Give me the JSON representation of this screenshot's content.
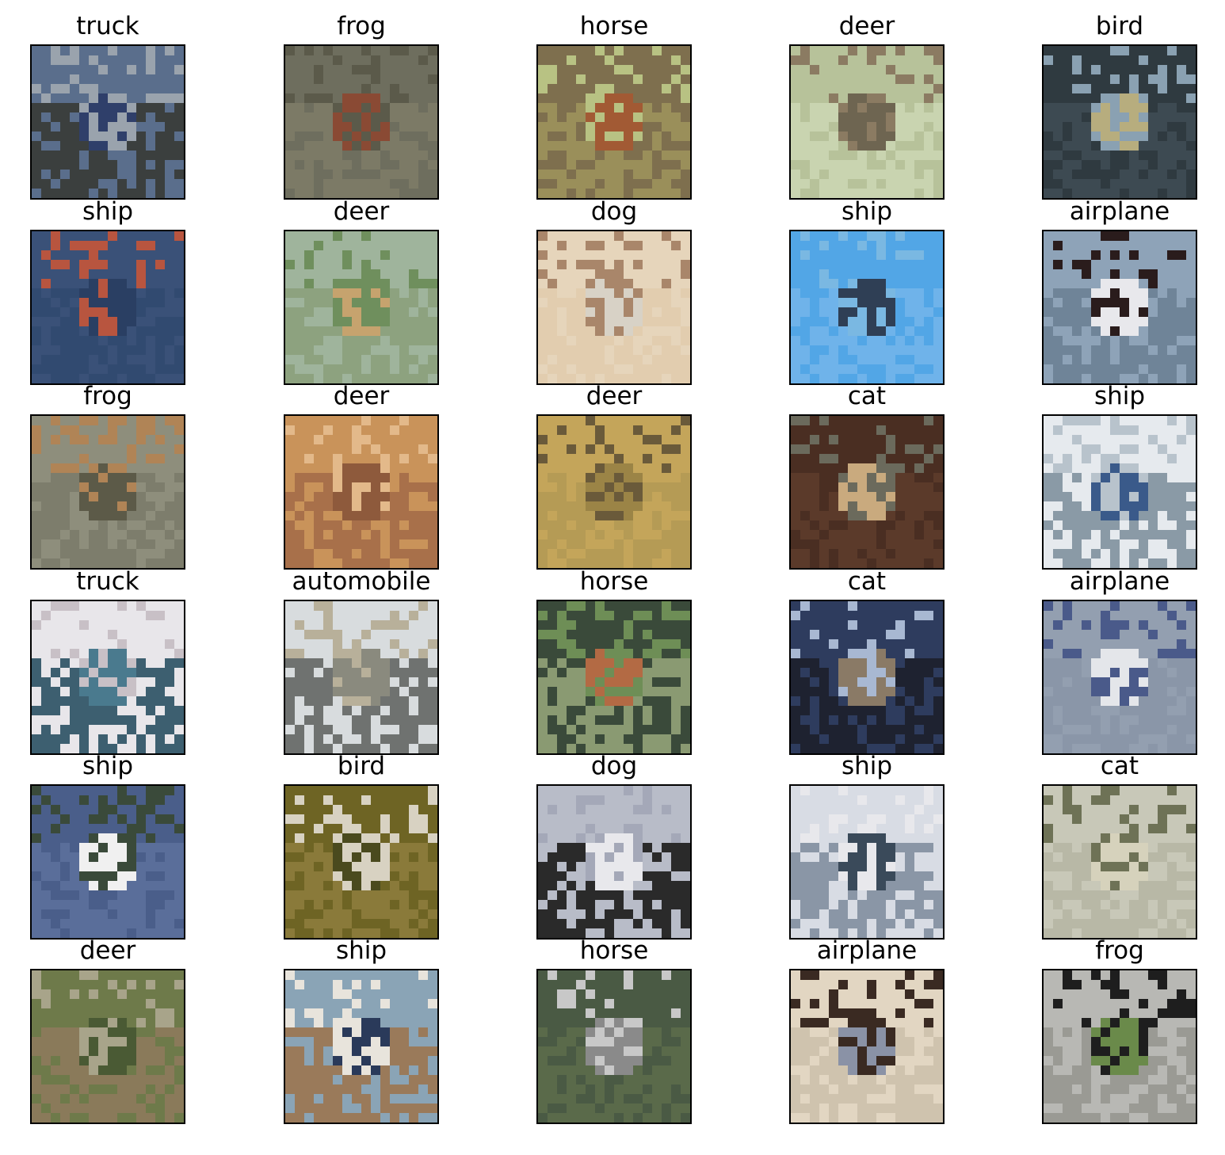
{
  "grid": {
    "rows": 6,
    "cols": 5,
    "cells": [
      {
        "label": "truck",
        "palette": [
          "#5a6e8c",
          "#2f3f6a",
          "#9aa3ad",
          "#3b3f3e"
        ]
      },
      {
        "label": "frog",
        "palette": [
          "#6e6e5e",
          "#8a4a34",
          "#5b5a4a",
          "#7c7a66"
        ]
      },
      {
        "label": "horse",
        "palette": [
          "#7e6f4e",
          "#a25a34",
          "#b8c283",
          "#9a8f5a"
        ]
      },
      {
        "label": "deer",
        "palette": [
          "#b7c29a",
          "#6e6551",
          "#8b7b62",
          "#c9d4b0"
        ]
      },
      {
        "label": "bird",
        "palette": [
          "#2f3a40",
          "#b7ad7e",
          "#8aa1b2",
          "#3d4a52"
        ]
      },
      {
        "label": "ship",
        "palette": [
          "#3a5178",
          "#2a3f63",
          "#b8553f",
          "#314a70"
        ]
      },
      {
        "label": "deer",
        "palette": [
          "#9fb49c",
          "#c6a36e",
          "#6f8f5d",
          "#8da27f"
        ]
      },
      {
        "label": "dog",
        "palette": [
          "#e6d5bb",
          "#d8d2c6",
          "#a9866a",
          "#e2cdaf"
        ]
      },
      {
        "label": "ship",
        "palette": [
          "#52a6e6",
          "#2f3f55",
          "#7ab8e2",
          "#6fb3ea"
        ]
      },
      {
        "label": "airplane",
        "palette": [
          "#8ea3b8",
          "#e8e8ec",
          "#2a1c1c",
          "#6f8498"
        ]
      },
      {
        "label": "frog",
        "palette": [
          "#8e8e7c",
          "#5c5a48",
          "#b08456",
          "#7d7d6c"
        ]
      },
      {
        "label": "deer",
        "palette": [
          "#c9935a",
          "#8e5a3c",
          "#e3b98a",
          "#a8704a"
        ]
      },
      {
        "label": "deer",
        "palette": [
          "#c4a55a",
          "#9b8446",
          "#6a5a3a",
          "#b59b55"
        ]
      },
      {
        "label": "cat",
        "palette": [
          "#4a2e22",
          "#c9aa7e",
          "#6b6a5c",
          "#5b3a2a"
        ]
      },
      {
        "label": "ship",
        "palette": [
          "#e6eaee",
          "#3a5a8a",
          "#b8c3cc",
          "#8a9aa6"
        ]
      },
      {
        "label": "truck",
        "palette": [
          "#e8e6ea",
          "#4a7a8e",
          "#c8c0c6",
          "#3d5f70"
        ]
      },
      {
        "label": "automobile",
        "palette": [
          "#d8dcde",
          "#8a8a7e",
          "#b8b09a",
          "#6f7270"
        ]
      },
      {
        "label": "horse",
        "palette": [
          "#3a4a3a",
          "#b36a44",
          "#6e8e56",
          "#8a9a72"
        ]
      },
      {
        "label": "cat",
        "palette": [
          "#2e3c5e",
          "#8a7a66",
          "#a8b8d2",
          "#1e2230"
        ]
      },
      {
        "label": "airplane",
        "palette": [
          "#939fb0",
          "#e4e6ea",
          "#4a5a8a",
          "#8a96a8"
        ]
      },
      {
        "label": "ship",
        "palette": [
          "#4a5e8a",
          "#f0f0f0",
          "#3a4a3a",
          "#5a6e9a"
        ]
      },
      {
        "label": "bird",
        "palette": [
          "#6e6424",
          "#4a4a1e",
          "#d8d2c2",
          "#8a7a3a"
        ]
      },
      {
        "label": "dog",
        "palette": [
          "#b8bcc8",
          "#e8e8ec",
          "#a4a8b8",
          "#2a2a2a"
        ]
      },
      {
        "label": "ship",
        "palette": [
          "#d8dce4",
          "#3a4a5a",
          "#e8e8ec",
          "#8a96a6"
        ]
      },
      {
        "label": "cat",
        "palette": [
          "#c8c8b8",
          "#d6d2bc",
          "#6e7256",
          "#b8b8a6"
        ]
      },
      {
        "label": "deer",
        "palette": [
          "#6e7a4a",
          "#4a5a34",
          "#a8a48a",
          "#8a7a5a"
        ]
      },
      {
        "label": "ship",
        "palette": [
          "#8aa4b6",
          "#2a3a5a",
          "#e8e4dc",
          "#9a7a5a"
        ]
      },
      {
        "label": "horse",
        "palette": [
          "#4a5a44",
          "#8a8a8a",
          "#c8c8c8",
          "#5a6a4a"
        ]
      },
      {
        "label": "airplane",
        "palette": [
          "#e2d6c2",
          "#8a92a6",
          "#3a2a22",
          "#cfc3ae"
        ]
      },
      {
        "label": "frog",
        "palette": [
          "#b8b8b4",
          "#6a8a4a",
          "#1e1e1e",
          "#9a9a94"
        ]
      }
    ]
  }
}
